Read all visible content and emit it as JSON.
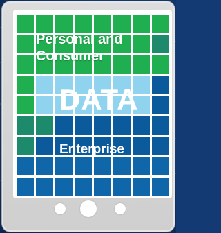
{
  "labels": {
    "personal": "Personal and Consumer",
    "data": "DATA",
    "enterprise": "Enterprise"
  },
  "colors": {
    "green": "#1fae50",
    "teal": "#1d8a6c",
    "light_blue": "#8fd3ef",
    "dark_blue": "#0b5a9c",
    "frame": "#d6d6d6"
  },
  "grid": {
    "rows": [
      [
        "g",
        "g",
        "g",
        "g",
        "g",
        "g",
        "g",
        "g"
      ],
      [
        "g",
        "g",
        "g",
        "g",
        "g",
        "g",
        "g",
        "t"
      ],
      [
        "g",
        "g",
        "g",
        "g",
        "g",
        "g",
        "g",
        "g"
      ],
      [
        "g",
        "lb",
        "lb",
        "lb",
        "lb",
        "lb",
        "lb",
        "db"
      ],
      [
        "g",
        "lb",
        "lb",
        "lb",
        "lb",
        "lb",
        "lb",
        "db"
      ],
      [
        "t",
        "t",
        "db",
        "db",
        "db",
        "db",
        "db",
        "db"
      ],
      [
        "t",
        "db",
        "db",
        "db",
        "db",
        "db",
        "db",
        "db"
      ],
      [
        "mb",
        "mb",
        "mb",
        "mb",
        "mb",
        "mb",
        "mb",
        "mb"
      ],
      [
        "mb",
        "mb",
        "mb",
        "mb",
        "mb",
        "mb",
        "mb",
        "mb"
      ]
    ]
  }
}
